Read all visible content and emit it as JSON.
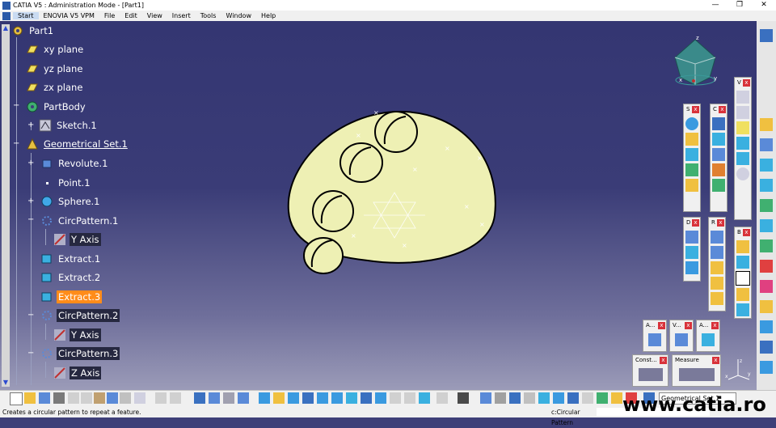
{
  "window": {
    "title": "CATIA V5 : Administration Mode - [Part1]",
    "min": "—",
    "max": "❐",
    "close": "✕"
  },
  "menu": [
    {
      "label": "Start"
    },
    {
      "label": "ENOVIA V5 VPM"
    },
    {
      "label": "File"
    },
    {
      "label": "Edit"
    },
    {
      "label": "View"
    },
    {
      "label": "Insert"
    },
    {
      "label": "Tools"
    },
    {
      "label": "Window"
    },
    {
      "label": "Help"
    }
  ],
  "tree": {
    "root": "Part1",
    "items": [
      {
        "label": "xy plane"
      },
      {
        "label": "yz plane"
      },
      {
        "label": "zx plane"
      },
      {
        "label": "PartBody"
      },
      {
        "label": "Sketch.1"
      },
      {
        "label": "Geometrical Set.1"
      },
      {
        "label": "Revolute.1"
      },
      {
        "label": "Point.1"
      },
      {
        "label": "Sphere.1"
      },
      {
        "label": "CircPattern.1"
      },
      {
        "label": "Y Axis"
      },
      {
        "label": "Extract.1"
      },
      {
        "label": "Extract.2"
      },
      {
        "label": "Extract.3"
      },
      {
        "label": "CircPattern.2"
      },
      {
        "label": "Y Axis"
      },
      {
        "label": "CircPattern.3"
      },
      {
        "label": "Z Axis"
      }
    ]
  },
  "panels": {
    "s": "S",
    "c": "C",
    "v": "V",
    "d": "D",
    "r": "R",
    "b": "B",
    "a1": "A...",
    "v2": "V...",
    "a2": "A...",
    "const": "Const...",
    "measure": "Measure"
  },
  "compass": {
    "x": "x",
    "y": "y",
    "z": "z"
  },
  "axis_triad": {
    "x": "x",
    "y": "y",
    "z": "z"
  },
  "bottom": {
    "combo": "Geometrical Set.1"
  },
  "status": {
    "message": "Creates a circular pattern to repeat a feature.",
    "command": "c:Circular Pattern"
  },
  "watermark": "www.catia.ro",
  "colors": {
    "selection": "#ff8c1a",
    "model": "#eef0b4",
    "viewport_top": "#343672",
    "close_red": "#d8323a"
  }
}
